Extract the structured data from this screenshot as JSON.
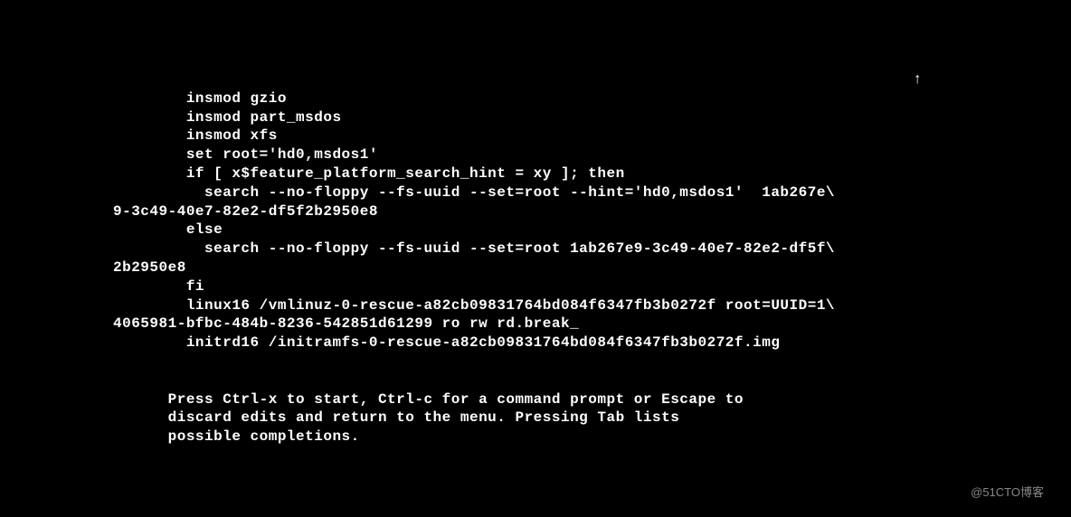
{
  "grub": {
    "lines": [
      "        insmod gzio",
      "        insmod part_msdos",
      "        insmod xfs",
      "        set root='hd0,msdos1'",
      "        if [ x$feature_platform_search_hint = xy ]; then",
      "          search --no-floppy --fs-uuid --set=root --hint='hd0,msdos1'  1ab267e\\",
      "9-3c49-40e7-82e2-df5f2b2950e8",
      "        else",
      "          search --no-floppy --fs-uuid --set=root 1ab267e9-3c49-40e7-82e2-df5f\\",
      "2b2950e8",
      "        fi",
      "        linux16 /vmlinuz-0-rescue-a82cb09831764bd084f6347fb3b0272f root=UUID=1\\",
      "4065981-bfbc-484b-8236-542851d61299 ro rw rd.break_",
      "        initrd16 /initramfs-0-rescue-a82cb09831764bd084f6347fb3b0272f.img",
      "",
      "",
      "      Press Ctrl-x to start, Ctrl-c for a command prompt or Escape to",
      "      discard edits and return to the menu. Pressing Tab lists",
      "      possible completions."
    ],
    "scroll_indicator": "↑"
  },
  "watermark": "@51CTO博客",
  "faded": ""
}
